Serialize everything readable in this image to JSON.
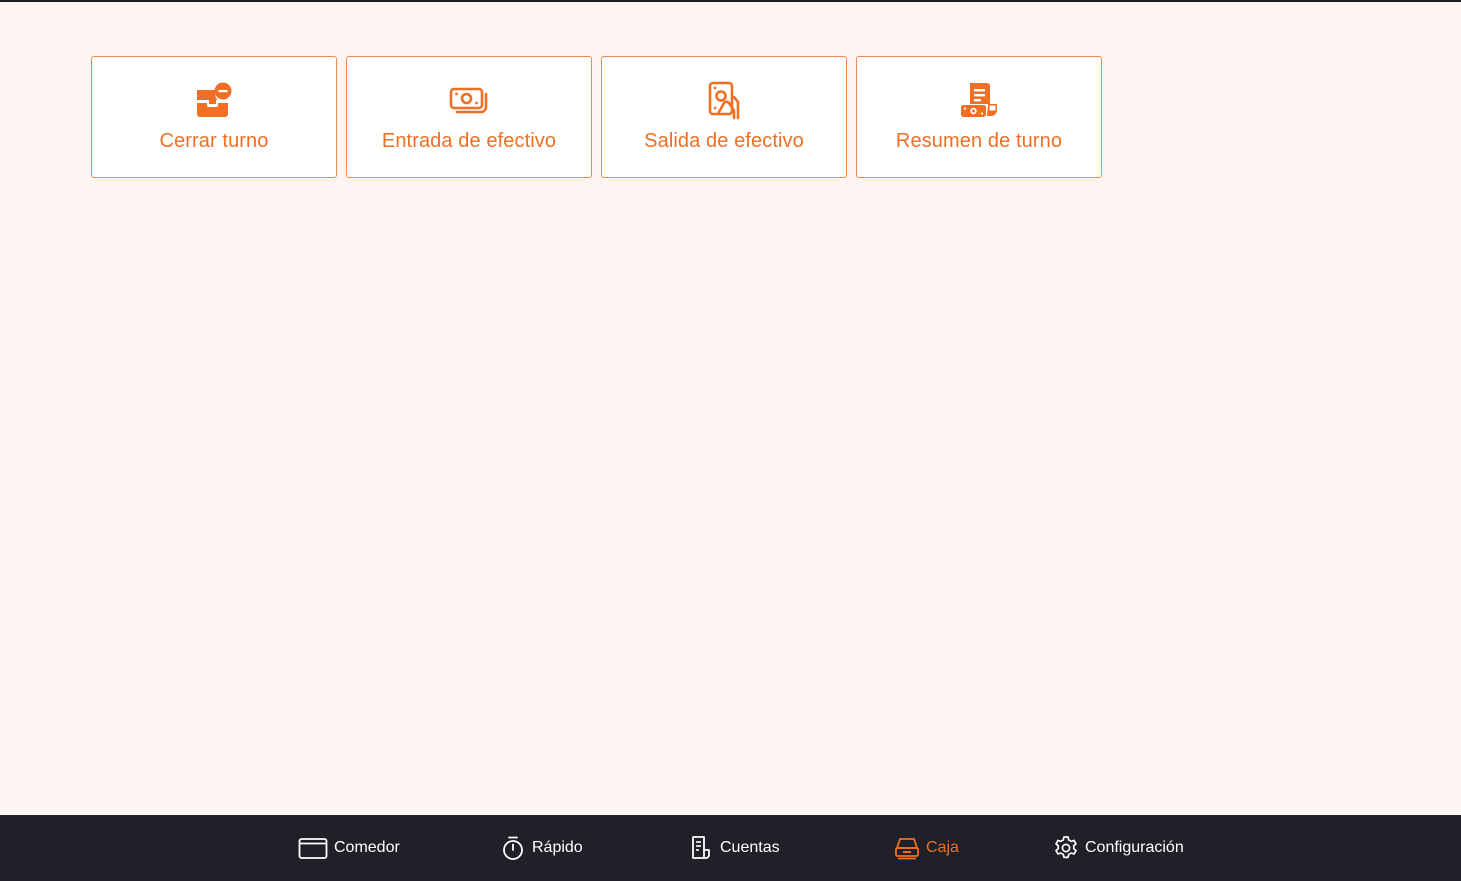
{
  "accent_color": "#ef6f25",
  "nav_background": "#1f2028",
  "page_background": "#fdf5f1",
  "actions": [
    {
      "label": "Cerrar turno",
      "icon": "close-shift-icon"
    },
    {
      "label": "Entrada de efectivo",
      "icon": "cash-in-icon"
    },
    {
      "label": "Salida de efectivo",
      "icon": "cash-out-icon"
    },
    {
      "label": "Resumen de turno",
      "icon": "shift-summary-icon"
    }
  ],
  "nav": {
    "items": [
      {
        "label": "Comedor",
        "icon": "dining-room-icon",
        "active": false
      },
      {
        "label": "Rápido",
        "icon": "stopwatch-icon",
        "active": false
      },
      {
        "label": "Cuentas",
        "icon": "receipt-icon",
        "active": false
      },
      {
        "label": "Caja",
        "icon": "cash-register-icon",
        "active": true
      },
      {
        "label": "Configuración",
        "icon": "gear-icon",
        "active": false
      }
    ]
  }
}
